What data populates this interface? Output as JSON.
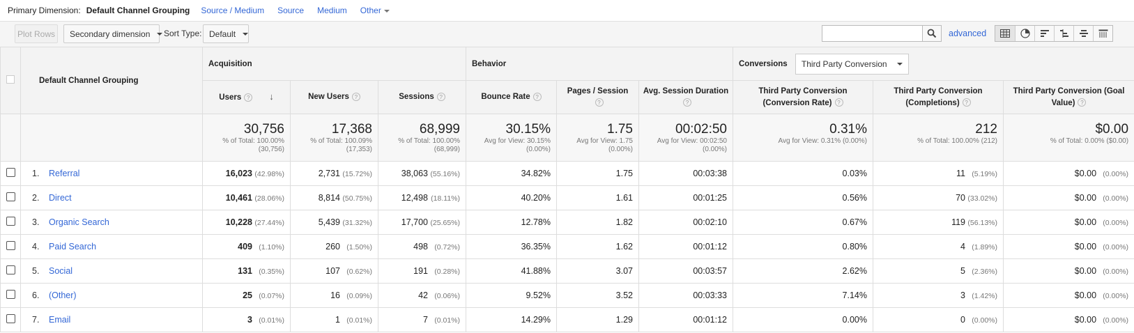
{
  "primary_dimension": {
    "label": "Primary Dimension:",
    "current": "Default Channel Grouping",
    "links": [
      "Source / Medium",
      "Source",
      "Medium"
    ],
    "other": "Other"
  },
  "toolbar": {
    "plot_rows": "Plot Rows",
    "secondary_dimension": "Secondary dimension",
    "sort_type_label": "Sort Type:",
    "sort_type_value": "Default",
    "search_value": "",
    "advanced": "advanced"
  },
  "table": {
    "dimension_header": "Default Channel Grouping",
    "groups": {
      "acquisition": "Acquisition",
      "behavior": "Behavior",
      "conversions": "Conversions",
      "conversion_select": "Third Party Conversion"
    },
    "columns": {
      "users": "Users",
      "new_users": "New Users",
      "sessions": "Sessions",
      "bounce_rate": "Bounce Rate",
      "pages_session": "Pages / Session",
      "avg_duration": "Avg. Session Duration",
      "conv_rate": "Third Party Conversion (Conversion Rate)",
      "completions": "Third Party Conversion (Completions)",
      "goal_value": "Third Party Conversion (Goal Value)"
    },
    "totals": {
      "users": {
        "value": "30,756",
        "l1": "% of Total: 100.00%",
        "l2": "(30,756)"
      },
      "new_users": {
        "value": "17,368",
        "l1": "% of Total: 100.09%",
        "l2": "(17,353)"
      },
      "sessions": {
        "value": "68,999",
        "l1": "% of Total: 100.00%",
        "l2": "(68,999)"
      },
      "bounce_rate": {
        "value": "30.15%",
        "l1": "Avg for View: 30.15%",
        "l2": "(0.00%)"
      },
      "pages_session": {
        "value": "1.75",
        "l1": "Avg for View: 1.75",
        "l2": "(0.00%)"
      },
      "avg_duration": {
        "value": "00:02:50",
        "l1": "Avg for View: 00:02:50",
        "l2": "(0.00%)"
      },
      "conv_rate": {
        "value": "0.31%",
        "l1": "Avg for View: 0.31% (0.00%)"
      },
      "completions": {
        "value": "212",
        "l1": "% of Total: 100.00% (212)"
      },
      "goal_value": {
        "value": "$0.00",
        "l1": "% of Total: 0.00% ($0.00)"
      }
    },
    "rows": [
      {
        "idx": "1.",
        "name": "Referral",
        "users": "16,023",
        "users_pct": "(42.98%)",
        "new_users": "2,731",
        "new_users_pct": "(15.72%)",
        "sessions": "38,063",
        "sessions_pct": "(55.16%)",
        "bounce": "34.82%",
        "pps": "1.75",
        "dur": "00:03:38",
        "conv_rate": "0.03%",
        "comp": "11",
        "comp_pct": "(5.19%)",
        "goal": "$0.00",
        "goal_pct": "(0.00%)"
      },
      {
        "idx": "2.",
        "name": "Direct",
        "users": "10,461",
        "users_pct": "(28.06%)",
        "new_users": "8,814",
        "new_users_pct": "(50.75%)",
        "sessions": "12,498",
        "sessions_pct": "(18.11%)",
        "bounce": "40.20%",
        "pps": "1.61",
        "dur": "00:01:25",
        "conv_rate": "0.56%",
        "comp": "70",
        "comp_pct": "(33.02%)",
        "goal": "$0.00",
        "goal_pct": "(0.00%)"
      },
      {
        "idx": "3.",
        "name": "Organic Search",
        "users": "10,228",
        "users_pct": "(27.44%)",
        "new_users": "5,439",
        "new_users_pct": "(31.32%)",
        "sessions": "17,700",
        "sessions_pct": "(25.65%)",
        "bounce": "12.78%",
        "pps": "1.82",
        "dur": "00:02:10",
        "conv_rate": "0.67%",
        "comp": "119",
        "comp_pct": "(56.13%)",
        "goal": "$0.00",
        "goal_pct": "(0.00%)"
      },
      {
        "idx": "4.",
        "name": "Paid Search",
        "users": "409",
        "users_pct": "(1.10%)",
        "new_users": "260",
        "new_users_pct": "(1.50%)",
        "sessions": "498",
        "sessions_pct": "(0.72%)",
        "bounce": "36.35%",
        "pps": "1.62",
        "dur": "00:01:12",
        "conv_rate": "0.80%",
        "comp": "4",
        "comp_pct": "(1.89%)",
        "goal": "$0.00",
        "goal_pct": "(0.00%)"
      },
      {
        "idx": "5.",
        "name": "Social",
        "users": "131",
        "users_pct": "(0.35%)",
        "new_users": "107",
        "new_users_pct": "(0.62%)",
        "sessions": "191",
        "sessions_pct": "(0.28%)",
        "bounce": "41.88%",
        "pps": "3.07",
        "dur": "00:03:57",
        "conv_rate": "2.62%",
        "comp": "5",
        "comp_pct": "(2.36%)",
        "goal": "$0.00",
        "goal_pct": "(0.00%)"
      },
      {
        "idx": "6.",
        "name": "(Other)",
        "users": "25",
        "users_pct": "(0.07%)",
        "new_users": "16",
        "new_users_pct": "(0.09%)",
        "sessions": "42",
        "sessions_pct": "(0.06%)",
        "bounce": "9.52%",
        "pps": "3.52",
        "dur": "00:03:33",
        "conv_rate": "7.14%",
        "comp": "3",
        "comp_pct": "(1.42%)",
        "goal": "$0.00",
        "goal_pct": "(0.00%)"
      },
      {
        "idx": "7.",
        "name": "Email",
        "users": "3",
        "users_pct": "(0.01%)",
        "new_users": "1",
        "new_users_pct": "(0.01%)",
        "sessions": "7",
        "sessions_pct": "(0.01%)",
        "bounce": "14.29%",
        "pps": "1.29",
        "dur": "00:01:12",
        "conv_rate": "0.00%",
        "comp": "0",
        "comp_pct": "(0.00%)",
        "goal": "$0.00",
        "goal_pct": "(0.00%)"
      }
    ]
  },
  "icons": {
    "search": "search-icon",
    "views": [
      "table-view-icon",
      "pie-view-icon",
      "performance-view-icon",
      "comparison-view-icon",
      "term-cloud-view-icon",
      "pivot-view-icon"
    ]
  }
}
